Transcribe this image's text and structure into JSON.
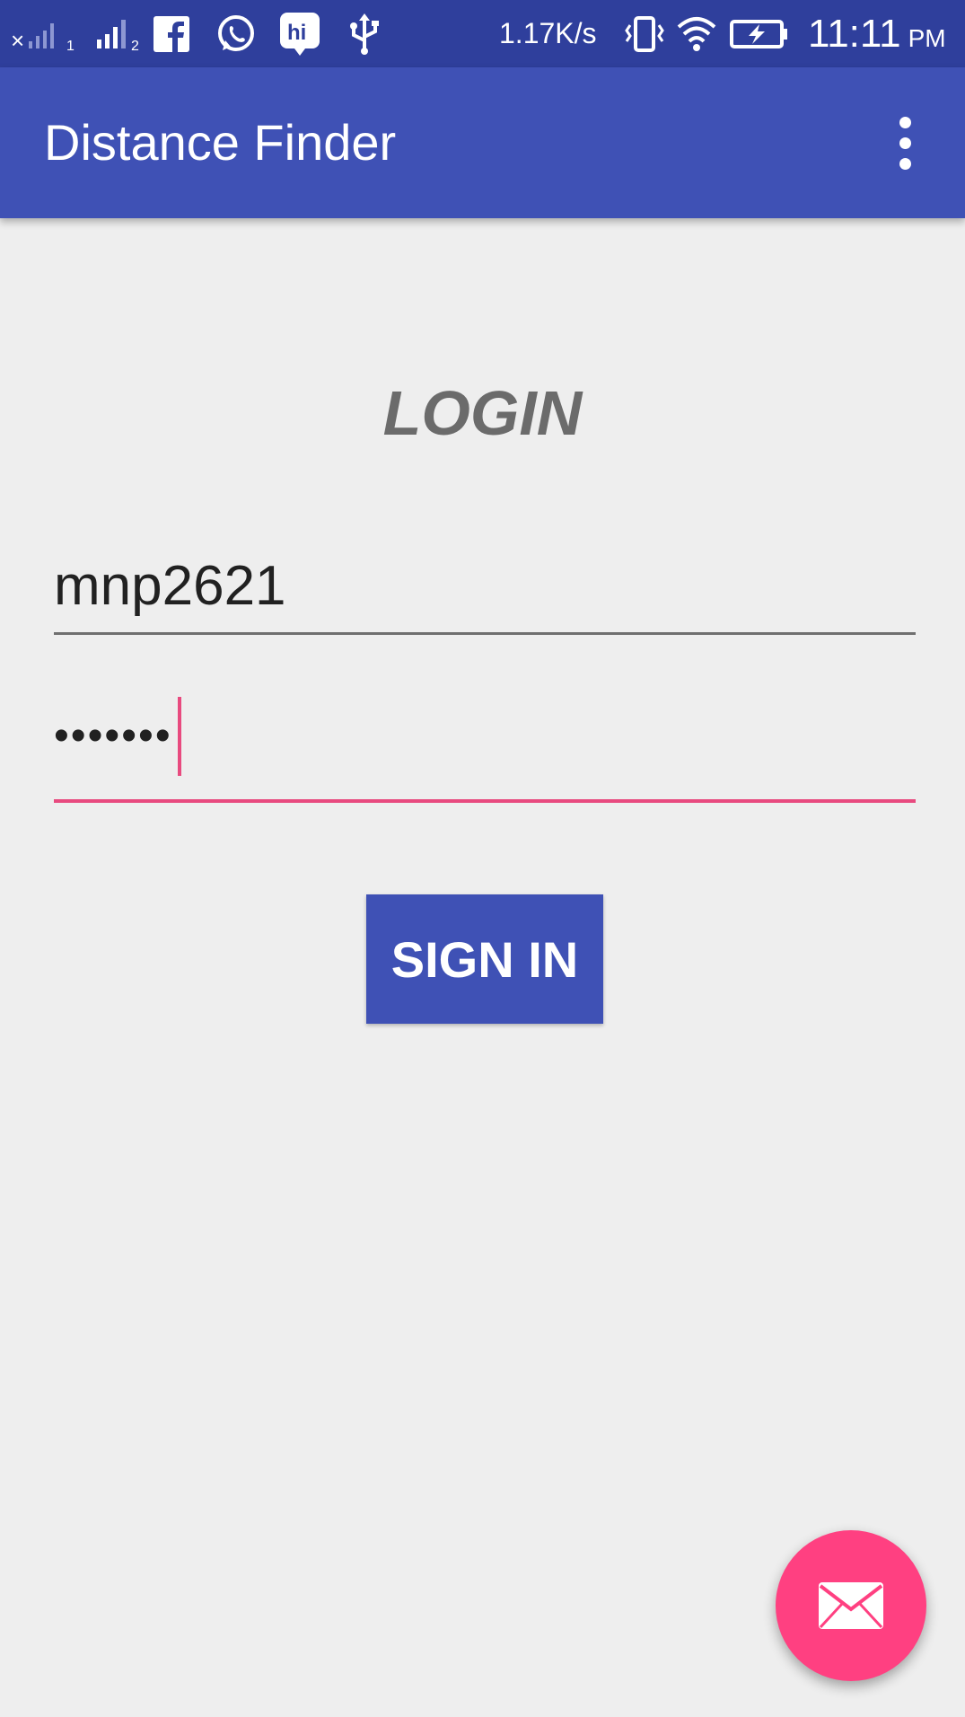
{
  "status_bar": {
    "sim1_label": "1",
    "sim2_label": "2",
    "net_speed": "1.17K/s",
    "time": "11:11",
    "ampm": "PM",
    "icons": [
      "signal-off-sim1-icon",
      "signal-sim2-icon",
      "facebook-icon",
      "whatsapp-icon",
      "hike-icon",
      "usb-icon",
      "vibrate-icon",
      "wifi-icon",
      "battery-charging-icon"
    ]
  },
  "app_bar": {
    "title": "Distance Finder",
    "overflow_icon": "more-vert-icon"
  },
  "login": {
    "heading": "LOGIN",
    "username_value": "mnp2621",
    "password_masked": "•••••••",
    "sign_in_label": "SIGN IN"
  },
  "fab": {
    "icon": "mail-icon"
  },
  "colors": {
    "status_bar": "#2f3f9c",
    "primary": "#3f51b5",
    "accent": "#ff4081",
    "background": "#eeeeee"
  }
}
